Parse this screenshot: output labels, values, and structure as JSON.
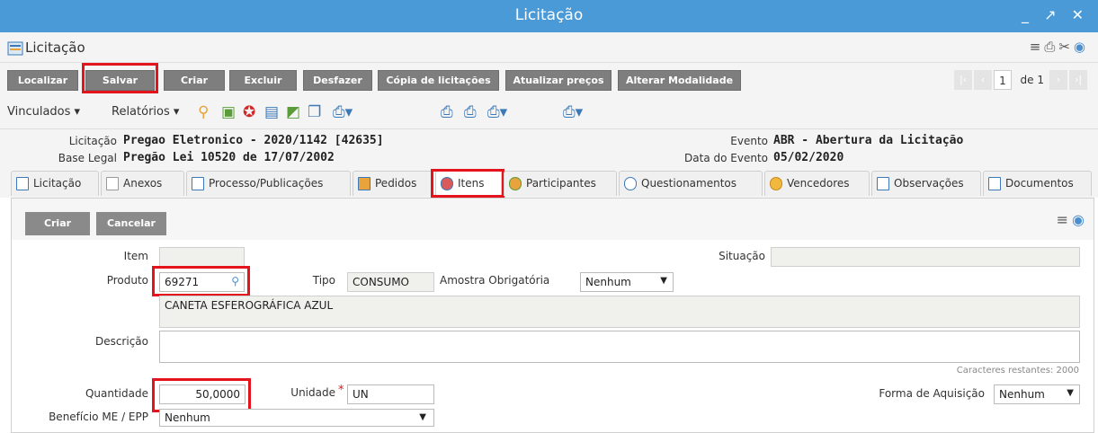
{
  "window": {
    "title": "Licitação",
    "controls": "_ ↗ ✕"
  },
  "header": {
    "title": "Licitação"
  },
  "toolbar": {
    "buttons": [
      "Localizar",
      "Salvar",
      "Criar",
      "Excluir",
      "Desfazer",
      "Cópia de licitações",
      "Atualizar preços",
      "Alterar Modalidade"
    ]
  },
  "pager": {
    "current": "1",
    "of_label": "de 1"
  },
  "menus": {
    "vinculados": "Vinculados ▾",
    "relatorios": "Relatórios ▾"
  },
  "info": {
    "licitacao_label": "Licitação",
    "licitacao_value": "Pregao Eletronico - 2020/1142 [42635]",
    "base_legal_label": "Base Legal",
    "base_legal_value": "Pregão Lei 10520 de 17/07/2002",
    "evento_label": "Evento",
    "evento_value": "ABR - Abertura da Licitação",
    "data_evento_label": "Data do Evento",
    "data_evento_value": "05/02/2020"
  },
  "tabs": [
    "Licitação",
    "Anexos",
    "Processo/Publicações",
    "Pedidos",
    "Itens",
    "Participantes",
    "Questionamentos",
    "Vencedores",
    "Observações",
    "Documentos"
  ],
  "form_buttons": {
    "criar": "Criar",
    "cancelar": "Cancelar"
  },
  "form": {
    "item_label": "Item",
    "situacao_label": "Situação",
    "produto_label": "Produto",
    "produto_value": "69271",
    "tipo_label": "Tipo",
    "tipo_value": "CONSUMO",
    "amostra_label": "Amostra Obrigatória",
    "amostra_value": "Nenhum",
    "produto_desc": "CANETA ESFEROGRÁFICA AZUL",
    "descricao_label": "Descrição",
    "counter": "Caracteres restantes: 2000",
    "quantidade_label": "Quantidade",
    "quantidade_value": "50,0000",
    "unidade_label": "Unidade",
    "unidade_value": "UN",
    "forma_label": "Forma de Aquisição",
    "forma_value": "Nenhum",
    "beneficio_label": "Benefício ME / EPP",
    "beneficio_value": "Nenhum"
  },
  "colors": {
    "titlebar": "#4a9ad8",
    "highlight": "#e3141c",
    "button": "#7e7e7e"
  }
}
